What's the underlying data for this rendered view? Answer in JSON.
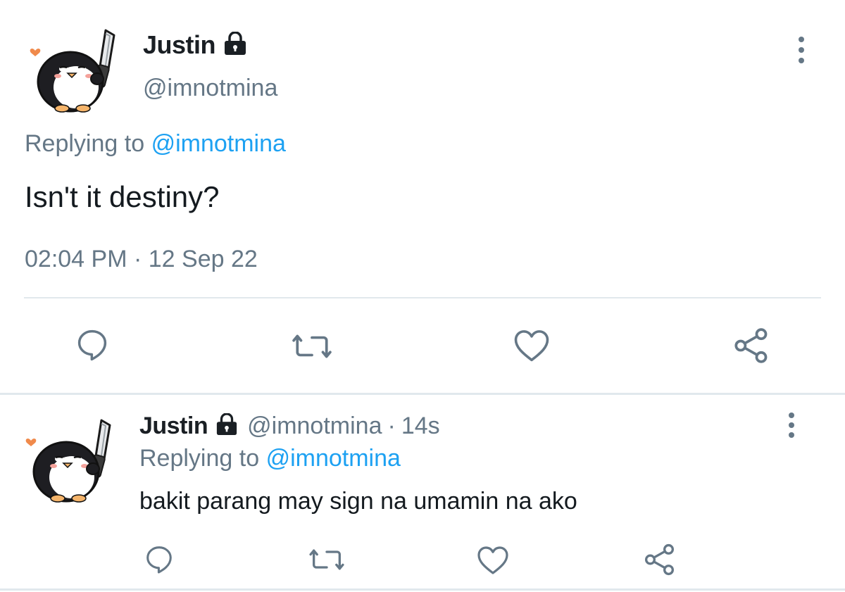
{
  "main_tweet": {
    "display_name": "Justin",
    "handle": "@imnotmina",
    "reply_prefix": "Replying to",
    "reply_to": "@imnotmina",
    "text": "Isn't it destiny?",
    "time": "02:04 PM",
    "separator": "·",
    "date": "12 Sep 22"
  },
  "reply_tweet": {
    "display_name": "Justin",
    "handle": "@imnotmina",
    "separator": "·",
    "age": "14s",
    "reply_prefix": "Replying to",
    "reply_to": "@imnotmina",
    "text": "bakit parang may sign na umamin na ako"
  },
  "icons": {
    "reply": "reply-icon",
    "retweet": "retweet-icon",
    "like": "heart-icon",
    "share": "share-icon",
    "lock": "lock-icon",
    "more": "more-vertical-icon",
    "avatar": "penguin-with-knife-avatar"
  },
  "colors": {
    "text": "#0f1419",
    "muted": "#657786",
    "link": "#1da1f2",
    "divider": "#e1e8ed",
    "background": "#ffffff"
  }
}
